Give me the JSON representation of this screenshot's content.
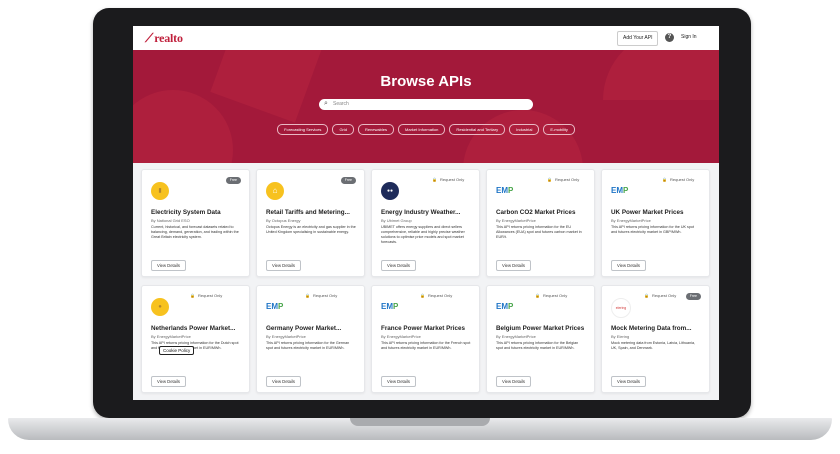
{
  "nav": {
    "logo": "realto",
    "add_api": "Add Your API",
    "help": "?",
    "signin": "Sign In"
  },
  "hero": {
    "title": "Browse APIs",
    "search_placeholder": "Search",
    "filters": [
      "Forecasting Services",
      "Grid",
      "Renewables",
      "Market Information",
      "Residential and Tertiary",
      "Industrial",
      "E-mobility"
    ]
  },
  "common": {
    "view_details": "View Details",
    "request_only": "Request Only",
    "free": "Free",
    "cookie_policy": "Cookie Policy"
  },
  "cards": [
    {
      "title": "Electricity System Data",
      "by": "By National Grid ESO",
      "desc": "Current, historical, and forecast datasets related to balancing, demand, generation, and trading within the Great Britain electricity system.",
      "icon": "bulb-icon"
    },
    {
      "title": "Retail Tariffs and Metering...",
      "by": "By Octopus Energy",
      "desc": "Octopus Energy is an electricity and gas supplier in the United Kingdom specialising in sustainable energy.",
      "icon": "house-icon"
    },
    {
      "title": "Energy Industry Weather...",
      "by": "By Ubimet Group",
      "desc": "UBIMET offers energy suppliers and direct sellers comprehensive, reliable and highly precise weather solutions to optimise price models and spot market forecasts.",
      "icon": "ubimet-logo-icon"
    },
    {
      "title": "Carbon CO2 Market Prices",
      "by": "By EnergyMarketPrice",
      "desc": "This API returns pricing information for the EU Allowances (EUA) spot and futures carbon market in EUR/t.",
      "icon": "emp-logo-icon"
    },
    {
      "title": "UK Power Market Prices",
      "by": "By EnergyMarketPrice",
      "desc": "This API returns pricing information for the UK spot and futures electricity market in GBP/MWh.",
      "icon": "emp-logo-icon"
    },
    {
      "title": "Netherlands Power Market...",
      "by": "By EnergyMarketPrice",
      "desc": "This API returns pricing information for the Dutch spot and futures electricity market in EUR/MWh.",
      "icon": "bulb-icon"
    },
    {
      "title": "Germany Power Market...",
      "by": "By EnergyMarketPrice",
      "desc": "This API returns pricing information for the German spot and futures electricity market in EUR/MWh.",
      "icon": "emp-logo-icon"
    },
    {
      "title": "France Power Market Prices",
      "by": "By EnergyMarketPrice",
      "desc": "This API returns pricing information for the French spot and futures electricity market in EUR/MWh.",
      "icon": "emp-logo-icon"
    },
    {
      "title": "Belgium Power Market Prices",
      "by": "By EnergyMarketPrice",
      "desc": "This API returns pricing information for the Belgian spot and futures electricity market in EUR/MWh.",
      "icon": "emp-logo-icon"
    },
    {
      "title": "Mock Metering Data from...",
      "by": "By Elering",
      "desc": "Mock metering data from Estonia, Latvia, Lithuania, UK, Spain, and Denmark.",
      "icon": "elering-logo-icon"
    }
  ],
  "colors": {
    "brand": "#c0203c",
    "hero_bg": "#a3193a",
    "page_bg": "#f2f3f5"
  }
}
